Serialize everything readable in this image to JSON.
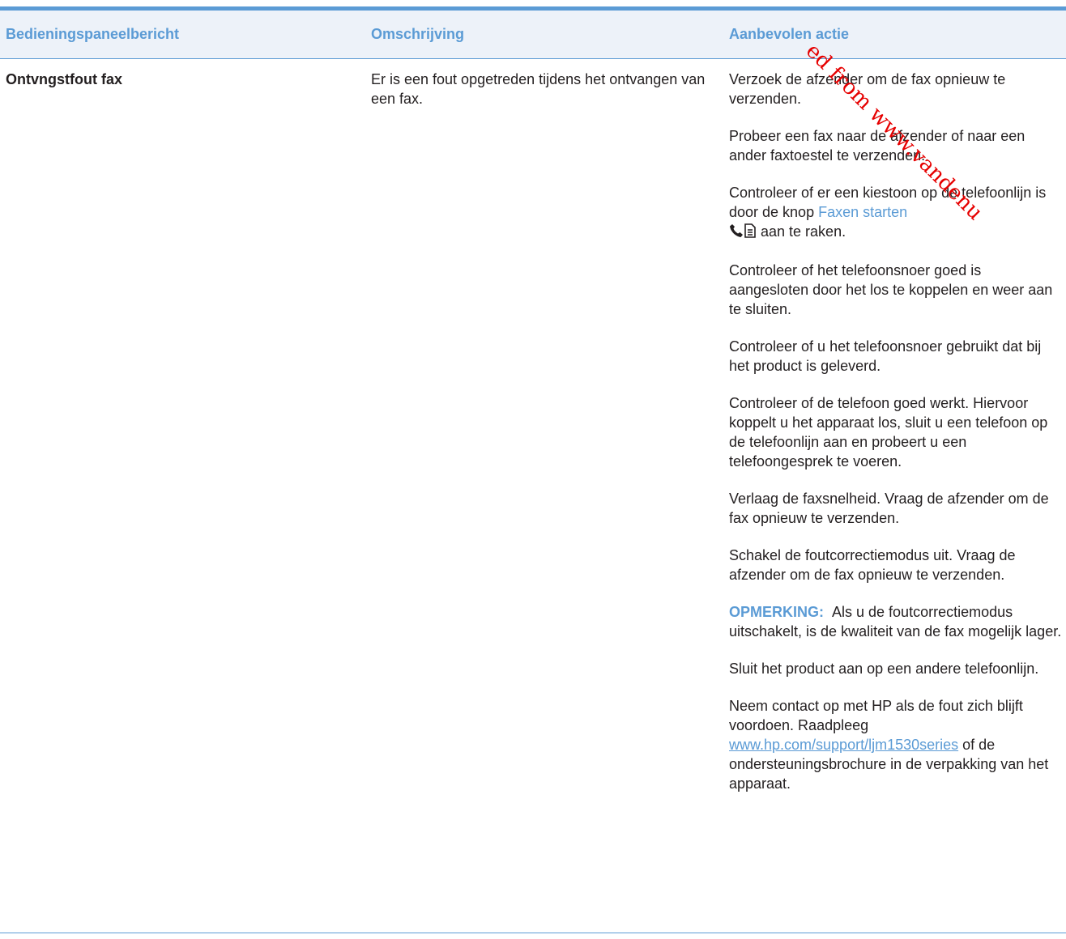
{
  "table": {
    "headers": [
      "Bedieningspaneelbericht",
      "Omschrijving",
      "Aanbevolen actie"
    ],
    "row": {
      "message": "Ontvngstfout fax",
      "description": "Er is een fout opgetreden tijdens het ontvangen van een fax.",
      "actions": [
        "Verzoek de afzender om de fax opnieuw te verzenden.",
        "Probeer een fax naar de afzender of naar een ander faxtoestel te verzenden.",
        {
          "before": "Controleer of er een kiestoon op de telefoonlijn is door de knop ",
          "button": "Faxen starten",
          "after": " aan te raken."
        },
        "Controleer of het telefoonsnoer goed is aangesloten door het los te koppelen en weer aan te sluiten.",
        "Controleer of u het telefoonsnoer gebruikt dat bij het product is geleverd.",
        "Controleer of de telefoon goed werkt. Hiervoor koppelt u het apparaat los, sluit u een telefoon op de telefoonlijn aan en probeert u een telefoongesprek te voeren.",
        "Verlaag de faxsnelheid. Vraag de afzender om de fax opnieuw te verzenden.",
        "Schakel de foutcorrectiemodus uit. Vraag de afzender om de fax opnieuw te verzenden.",
        {
          "label": "OPMERKING:",
          "text": "Als u de foutcorrectiemodus uitschakelt, is de kwaliteit van de fax mogelijk lager."
        },
        "Sluit het product aan op een andere telefoonlijn.",
        {
          "before": "Neem contact op met HP als de fout zich blijft voordoen. Raadpleeg ",
          "link": "www.hp.com/support/ljm1530series",
          "after": " of de ondersteuningsbrochure in de verpakking van het apparaat."
        }
      ]
    }
  },
  "watermark": "ed from www.vandenu",
  "colors": {
    "accent": "#5b9bd5",
    "header_bg": "#edf2f9",
    "watermark": "#e60000"
  },
  "icons": [
    "phone-icon",
    "document-icon"
  ]
}
